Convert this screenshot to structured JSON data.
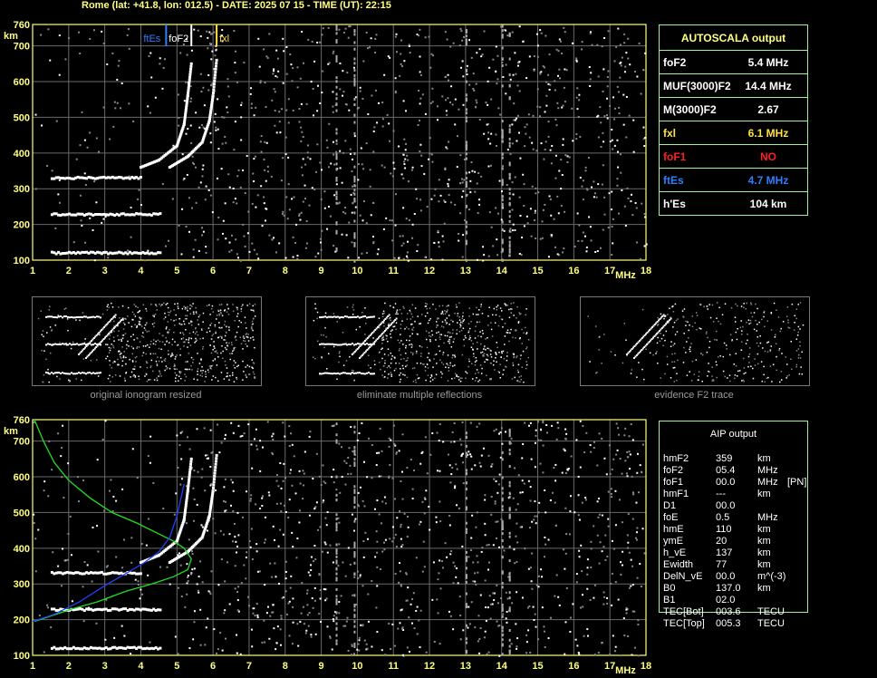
{
  "title": "Rome (lat: +41.8, lon: 012.5) - DATE: 2025 07 15 - TIME (UT): 22:15",
  "chart_data": [
    {
      "type": "scatter",
      "xlabel": "MHz",
      "ylabel": "km",
      "xlim": [
        1,
        18
      ],
      "ylim": [
        100,
        760
      ],
      "xticks": [
        "1",
        "2",
        "3",
        "4",
        "5",
        "6",
        "7",
        "8",
        "9",
        "10",
        "11",
        "12",
        "13",
        "14",
        "15",
        "16",
        "17",
        "18"
      ],
      "yticks": [
        "100",
        "200",
        "300",
        "400",
        "500",
        "600",
        "700",
        "760"
      ],
      "markers": [
        {
          "label": "ftEs",
          "x": 4.7,
          "color": "#2f7fff"
        },
        {
          "label": "foF2",
          "x": 5.4,
          "color": "#ffffff"
        },
        {
          "label": "fxl",
          "x": 6.1,
          "color": "#ffe040"
        }
      ],
      "traces": [
        {
          "name": "Es trace 1",
          "x": [
            1.5,
            4.5
          ],
          "y": 120
        },
        {
          "name": "Es trace 2",
          "x": [
            1.5,
            4.5
          ],
          "y": 228
        },
        {
          "name": "Es trace 3",
          "x": [
            1.5,
            4.0
          ],
          "y": 330
        },
        {
          "name": "F2 O trace",
          "x": [
            4.0,
            4.5,
            5.0,
            5.2,
            5.3,
            5.4
          ],
          "y": [
            360,
            380,
            420,
            480,
            560,
            650
          ]
        },
        {
          "name": "F2 X trace",
          "x": [
            4.8,
            5.3,
            5.7,
            5.9,
            6.0,
            6.1
          ],
          "y": [
            360,
            390,
            430,
            490,
            560,
            660
          ]
        }
      ]
    },
    {
      "type": "scatter",
      "xlabel": "MHz",
      "ylabel": "km",
      "xlim": [
        1,
        18
      ],
      "ylim": [
        100,
        760
      ],
      "xticks": [
        "1",
        "2",
        "3",
        "4",
        "5",
        "6",
        "7",
        "8",
        "9",
        "10",
        "11",
        "12",
        "13",
        "14",
        "15",
        "16",
        "17",
        "18"
      ],
      "yticks": [
        "100",
        "200",
        "300",
        "400",
        "500",
        "600",
        "700",
        "760"
      ],
      "profiles": [
        {
          "name": "electron density profile",
          "color": "#20e020",
          "x": [
            1.05,
            1.3,
            1.6,
            2.0,
            2.6,
            3.2,
            3.9,
            4.5,
            4.9,
            5.2,
            5.4,
            5.3,
            4.9,
            4.3,
            3.6,
            2.8,
            2.1,
            1.5,
            1.05
          ],
          "y": [
            760,
            700,
            640,
            590,
            540,
            500,
            470,
            440,
            420,
            400,
            370,
            340,
            320,
            300,
            280,
            250,
            230,
            210,
            195
          ]
        },
        {
          "name": "virtual height fit",
          "color": "#2040ff",
          "x": [
            1.0,
            1.6,
            2.3,
            3.0,
            3.6,
            4.1,
            4.5,
            4.8,
            5.0,
            5.2
          ],
          "y": [
            195,
            215,
            250,
            295,
            330,
            360,
            390,
            430,
            490,
            580
          ]
        }
      ],
      "traces": [
        {
          "name": "Es trace 1",
          "x": [
            1.5,
            4.5
          ],
          "y": 120
        },
        {
          "name": "Es trace 2",
          "x": [
            1.5,
            4.5
          ],
          "y": 228
        },
        {
          "name": "Es trace 3",
          "x": [
            1.5,
            4.0
          ],
          "y": 330
        },
        {
          "name": "F2 O trace",
          "x": [
            4.0,
            4.5,
            5.0,
            5.2,
            5.3,
            5.4
          ],
          "y": [
            360,
            380,
            420,
            480,
            560,
            650
          ]
        },
        {
          "name": "F2 X trace",
          "x": [
            4.8,
            5.3,
            5.7,
            5.9,
            6.0,
            6.1
          ],
          "y": [
            360,
            390,
            430,
            490,
            560,
            660
          ]
        }
      ]
    }
  ],
  "autoscala": {
    "title": "AUTOSCALA output",
    "rows": [
      {
        "key": "foF2",
        "value": "5.4  MHz",
        "kcolor": "#ffffff",
        "vcolor": "#ffffff"
      },
      {
        "key": "MUF(3000)F2",
        "value": "14.4  MHz",
        "kcolor": "#ffffff",
        "vcolor": "#ffffff"
      },
      {
        "key": "M(3000)F2",
        "value": "2.67",
        "kcolor": "#ffffff",
        "vcolor": "#ffffff"
      },
      {
        "key": "fxl",
        "value": "6.1  MHz",
        "kcolor": "#ffe040",
        "vcolor": "#ffe040"
      },
      {
        "key": "foF1",
        "value": "NO",
        "kcolor": "#ff2020",
        "vcolor": "#ff2020"
      },
      {
        "key": "ftEs",
        "value": "4.7  MHz",
        "kcolor": "#2f7fff",
        "vcolor": "#2f7fff"
      },
      {
        "key": "h'Es",
        "value": "104      km",
        "kcolor": "#ffffff",
        "vcolor": "#ffffff"
      }
    ]
  },
  "thumbnails": [
    {
      "caption": "original ionogram resized"
    },
    {
      "caption": "eliminate multiple reflections"
    },
    {
      "caption": "evidence F2 trace"
    }
  ],
  "aip": {
    "title": "AIP output",
    "rows": [
      {
        "k": "hmF2",
        "v": "359",
        "u": "km",
        "e": ""
      },
      {
        "k": "foF2",
        "v": "05.4",
        "u": "MHz",
        "e": ""
      },
      {
        "k": "foF1",
        "v": "00.0",
        "u": "MHz",
        "e": "[PN]"
      },
      {
        "k": "hmF1",
        "v": "---",
        "u": "km",
        "e": ""
      },
      {
        "k": "D1",
        "v": "00.0",
        "u": "",
        "e": ""
      },
      {
        "k": "foE",
        "v": "0.5",
        "u": "MHz",
        "e": ""
      },
      {
        "k": "hmE",
        "v": "110",
        "u": "km",
        "e": ""
      },
      {
        "k": "ymE",
        "v": "20",
        "u": "km",
        "e": ""
      },
      {
        "k": "h_vE",
        "v": "137",
        "u": "km",
        "e": ""
      },
      {
        "k": "Ewidth",
        "v": "77",
        "u": "km",
        "e": ""
      },
      {
        "k": "DelN_vE",
        "v": "00.0",
        "u": "m^(-3)",
        "e": ""
      },
      {
        "k": "B0",
        "v": "137.0",
        "u": "km",
        "e": ""
      },
      {
        "k": "B1",
        "v": "02.0",
        "u": "",
        "e": ""
      },
      {
        "k": "TEC[Bot]",
        "v": "003.6",
        "u": "TECU",
        "e": ""
      },
      {
        "k": "TEC[Top]",
        "v": "005.3",
        "u": "TECU",
        "e": ""
      }
    ]
  }
}
